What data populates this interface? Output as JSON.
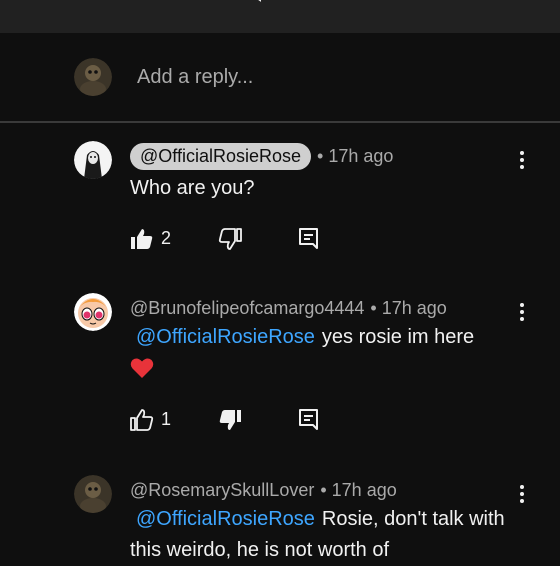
{
  "reply_box": {
    "placeholder": "Add a reply..."
  },
  "comments": [
    {
      "author": "@OfficialRosieRose",
      "time": "17h ago",
      "text": "Who are you?",
      "likes": "2"
    },
    {
      "author": "@Brunofelipeofcamargo4444",
      "time": "17h ago",
      "mention": "@OfficialRosieRose",
      "text": "yes rosie im here",
      "emoji": "heart-icon",
      "likes": "1"
    },
    {
      "author": "@RosemarySkullLover",
      "time": "17h ago",
      "mention": "@OfficialRosieRose",
      "text": "Rosie, don't talk with this weirdo, he is not worth of"
    }
  ],
  "colors": {
    "mention": "#3ea6ff",
    "heart": "#e8333a",
    "background": "#0f0f0f"
  }
}
